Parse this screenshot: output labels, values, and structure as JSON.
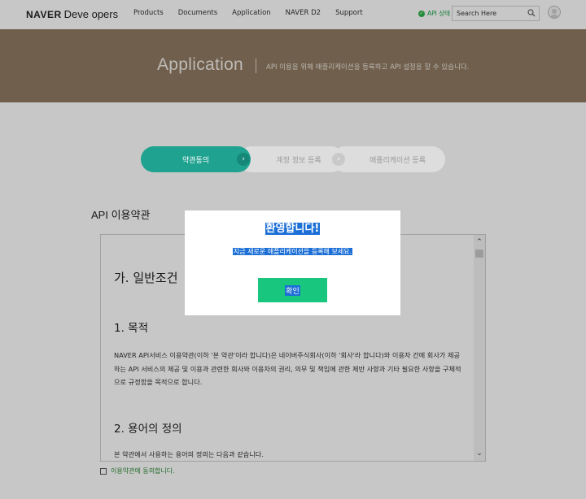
{
  "header": {
    "logo_brand": "NAVER",
    "logo_product": "Deve opers",
    "nav": [
      "Products",
      "Documents",
      "Application",
      "NAVER D2",
      "Support"
    ],
    "api_status": "API 상태",
    "search_placeholder": "Search Here"
  },
  "banner": {
    "title": "Application",
    "description": "API 이용을 위해 애플리케이션을 등록하고 API 설정을 할 수 있습니다."
  },
  "steps": [
    {
      "label": "약관동의",
      "active": true
    },
    {
      "label": "계정 정보 등록",
      "active": false
    },
    {
      "label": "애플리케이션 등록",
      "active": false
    }
  ],
  "terms": {
    "title": "API 이용약관",
    "section": "가. 일반조건",
    "sub1": "1. 목적",
    "para1": "NAVER API서비스 이용약관(이하 '본 약관'이라 합니다)은 네이버주식회사(이하 '회사'라 합니다)와 이용자 간에 회사가 제공하는 API 서비스의 제공 및 이용과 관련한 회사와 이용자의 권리, 의무 및 책임에 관한 제반 사항과 기타 필요한 사항을 구체적으로 규정함을 목적으로 합니다.",
    "sub2": "2. 용어의 정의",
    "para2": "본 약관에서 사용하는 용어의 정의는 다음과 같습니다.",
    "agree_label": "이용약관에 동의합니다."
  },
  "modal": {
    "title": "환영합니다!",
    "message": "지금 새로운 애플리케이션을 등록해 보세요.",
    "confirm": "확인"
  },
  "colors": {
    "banner": "#8f7a62",
    "step_active": "#1fa28f",
    "confirm_button": "#18c77d",
    "selection": "#1c6fd6"
  }
}
